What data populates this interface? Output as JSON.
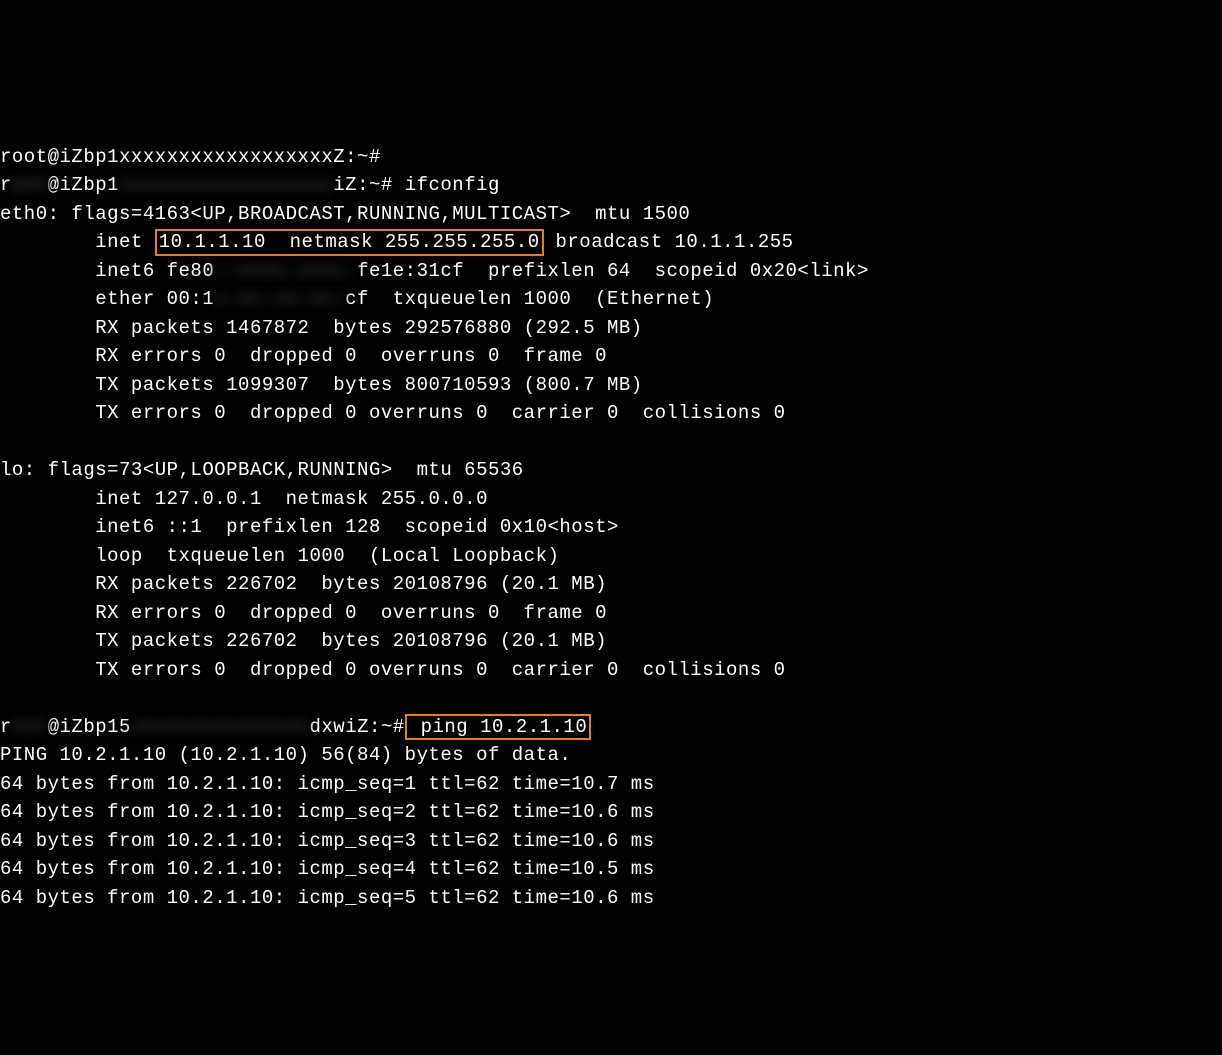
{
  "top_fragment": "root@iZbp1xxxxxxxxxxxxxxxxxxZ:~#",
  "prompt1_pre": "r",
  "prompt1_redact": "oot",
  "prompt1_mid": "@iZbp1",
  "prompt1_redact2": "xxxxxxxxxxxxxxxxxx",
  "prompt1_post": "iZ:~# ifconfig",
  "eth0_line1": "eth0: flags=4163<UP,BROADCAST,RUNNING,MULTICAST>  mtu 1500",
  "inet_prefix": "        inet ",
  "inet_highlight": "10.1.1.10  netmask 255.255.255.0",
  "inet_suffix": " broadcast 10.1.1.255",
  "inet6_prefix": "        inet6 fe80",
  "inet6_redact": "::xxxx:xxxx:",
  "inet6_suffix": "fe1e:31cf  prefixlen 64  scopeid 0x20<link>",
  "ether_prefix": "        ether 00:1",
  "ether_redact": "x:xx:xx:xx:",
  "ether_suffix": "cf  txqueuelen 1000  (Ethernet)",
  "eth0_rx_packets": "        RX packets 1467872  bytes 292576880 (292.5 MB)",
  "eth0_rx_errors": "        RX errors 0  dropped 0  overruns 0  frame 0",
  "eth0_tx_packets": "        TX packets 1099307  bytes 800710593 (800.7 MB)",
  "eth0_tx_errors": "        TX errors 0  dropped 0 overruns 0  carrier 0  collisions 0",
  "blank": "",
  "lo_line1": "lo: flags=73<UP,LOOPBACK,RUNNING>  mtu 65536",
  "lo_inet": "        inet 127.0.0.1  netmask 255.0.0.0",
  "lo_inet6": "        inet6 ::1  prefixlen 128  scopeid 0x10<host>",
  "lo_loop": "        loop  txqueuelen 1000  (Local Loopback)",
  "lo_rx_packets": "        RX packets 226702  bytes 20108796 (20.1 MB)",
  "lo_rx_errors": "        RX errors 0  dropped 0  overruns 0  frame 0",
  "lo_tx_packets": "        TX packets 226702  bytes 20108796 (20.1 MB)",
  "lo_tx_errors": "        TX errors 0  dropped 0 overruns 0  carrier 0  collisions 0",
  "prompt2_pre": "r",
  "prompt2_redact": "oot",
  "prompt2_mid": "@iZbp15",
  "prompt2_redact2": "xxxxxxxxxxxxxxx",
  "prompt2_post": "dxwiZ:~#",
  "ping_cmd": " ping 10.2.1.10",
  "ping_header": "PING 10.2.1.10 (10.2.1.10) 56(84) bytes of data.",
  "ping_1": "64 bytes from 10.2.1.10: icmp_seq=1 ttl=62 time=10.7 ms",
  "ping_2": "64 bytes from 10.2.1.10: icmp_seq=2 ttl=62 time=10.6 ms",
  "ping_3": "64 bytes from 10.2.1.10: icmp_seq=3 ttl=62 time=10.6 ms",
  "ping_4": "64 bytes from 10.2.1.10: icmp_seq=4 ttl=62 time=10.5 ms",
  "ping_5": "64 bytes from 10.2.1.10: icmp_seq=5 ttl=62 time=10.6 ms"
}
